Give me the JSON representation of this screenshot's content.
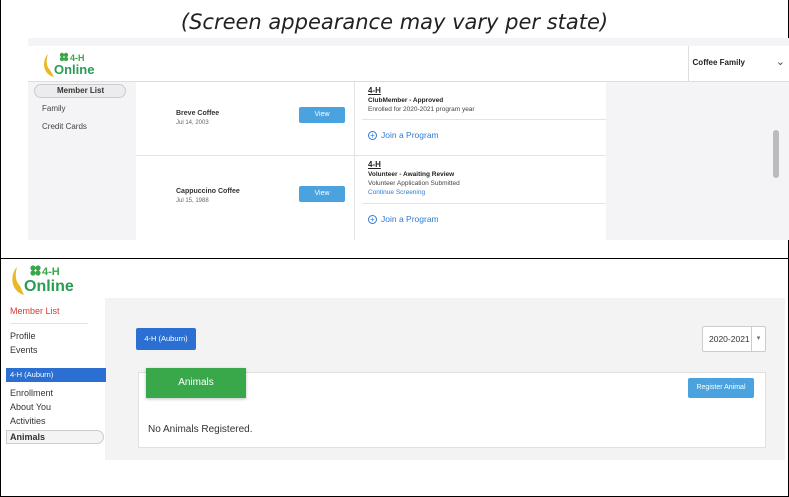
{
  "caption": "(Screen appearance may vary per state)",
  "logo": {
    "line1": "4-H",
    "line2": "Online"
  },
  "top_screen": {
    "family_name": "Coffee Family",
    "sidebar": [
      "Member List",
      "Family",
      "Credit Cards"
    ],
    "members": [
      {
        "name": "Breve Coffee",
        "date": "Jul 14, 2003",
        "view_label": "View",
        "program": "4-H",
        "status": "ClubMember - Approved",
        "note": "Enrolled for 2020-2021 program year",
        "link": "",
        "join_label": "Join a Program"
      },
      {
        "name": "Cappuccino Coffee",
        "date": "Jul 15, 1988",
        "view_label": "View",
        "program": "4-H",
        "status": "Volunteer - Awaiting Review",
        "note": "Volunteer Application Submitted",
        "link": "Continue Screening",
        "join_label": "Join a Program"
      }
    ]
  },
  "bottom_screen": {
    "sidebar": {
      "member_list": "Member List",
      "profile": "Profile",
      "events": "Events",
      "club": "4-H (Auburn)",
      "enrollment": "Enrollment",
      "about_you": "About You",
      "activities": "Activities",
      "animals": "Animals"
    },
    "club_button": "4-H (Auburn)",
    "year": "2020-2021",
    "tab_label": "Animals",
    "register_button": "Register Animal",
    "empty_message": "No Animals Registered."
  },
  "colors": {
    "brand_green": "#39a84a",
    "primary_blue": "#2a6fd1",
    "light_blue": "#4aa3df",
    "alert_red": "#d73a30"
  }
}
